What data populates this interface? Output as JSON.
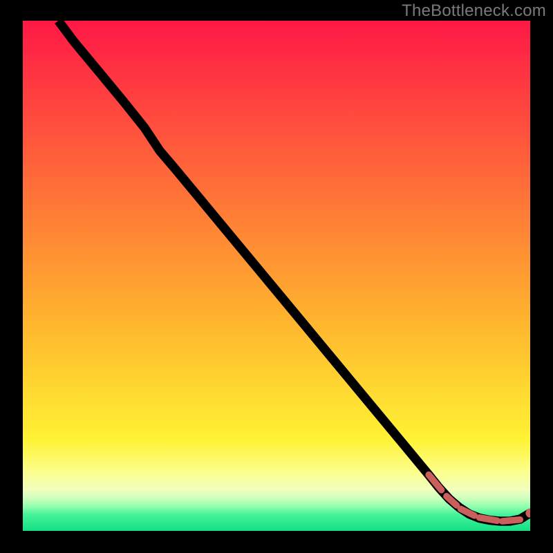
{
  "watermark": "TheBottleneck.com",
  "colors": {
    "marker": "#cb5f5b",
    "line": "#000000",
    "bg_black": "#000000"
  },
  "gradient_bands": [
    {
      "top_pct": 0.0,
      "height_pct": 58.0,
      "from": "#ff1846",
      "to": "#ffb22e"
    },
    {
      "top_pct": 58.0,
      "height_pct": 24.0,
      "from": "#ffb22e",
      "to": "#fff233"
    },
    {
      "top_pct": 82.0,
      "height_pct": 6.5,
      "from": "#fff233",
      "to": "#fcff8d"
    },
    {
      "top_pct": 88.5,
      "height_pct": 3.5,
      "from": "#fcff8d",
      "to": "#f1ffc0"
    },
    {
      "top_pct": 92.0,
      "height_pct": 1.8,
      "from": "#f1ffc0",
      "to": "#c8ffbd"
    },
    {
      "top_pct": 93.8,
      "height_pct": 1.5,
      "from": "#c8ffbd",
      "to": "#8fffad"
    },
    {
      "top_pct": 95.3,
      "height_pct": 1.5,
      "from": "#8fffad",
      "to": "#47f39a"
    },
    {
      "top_pct": 96.8,
      "height_pct": 3.2,
      "from": "#47f39a",
      "to": "#14df85"
    }
  ],
  "chart_data": {
    "type": "line",
    "title": "",
    "xlabel": "",
    "ylabel": "",
    "xlim": [
      0,
      100
    ],
    "ylim": [
      0,
      100
    ],
    "series": [
      {
        "name": "curve",
        "x": [
          7,
          10,
          15,
          20,
          24,
          27,
          30,
          35,
          40,
          45,
          50,
          55,
          60,
          65,
          70,
          75,
          80,
          82,
          84,
          86,
          88,
          90,
          92,
          94,
          96,
          98,
          100
        ],
        "y": [
          100,
          96,
          90,
          84,
          79,
          74.5,
          71,
          65,
          59,
          53,
          47,
          41,
          35,
          29,
          23,
          17,
          11,
          8.5,
          6.3,
          4.6,
          3.3,
          2.5,
          2.1,
          1.9,
          1.9,
          2.3,
          3.5
        ]
      }
    ],
    "markers": {
      "name": "highlight",
      "segments": [
        {
          "x": [
            80,
            82.5
          ],
          "y": [
            11,
            8.0
          ]
        },
        {
          "x": [
            83.5,
            85.5
          ],
          "y": [
            6.8,
            5.0
          ]
        },
        {
          "x": [
            86.3,
            89.0
          ],
          "y": [
            4.3,
            3.0
          ]
        },
        {
          "x": [
            90.0,
            93.5
          ],
          "y": [
            2.6,
            2.0
          ]
        },
        {
          "x": [
            94.5,
            98.0
          ],
          "y": [
            1.9,
            2.2
          ]
        }
      ],
      "end_dot": {
        "x": 100,
        "y": 3.5
      }
    }
  }
}
